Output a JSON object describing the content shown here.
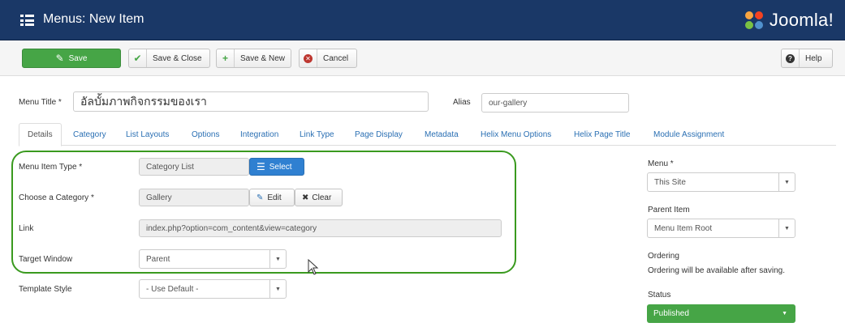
{
  "header": {
    "title": "Menus: New Item",
    "logo_text": "Joomla!",
    "colors": {
      "bar": "#1a3867"
    }
  },
  "toolbar": {
    "save_label": "Save",
    "save_close_label": "Save & Close",
    "save_new_label": "Save & New",
    "cancel_label": "Cancel",
    "help_label": "Help"
  },
  "form": {
    "menu_title_label": "Menu Title *",
    "menu_title_value": "อัลบั้มภาพกิจกรรมของเรา",
    "alias_label": "Alias",
    "alias_value": "our-gallery"
  },
  "tabs": [
    {
      "label": "Details"
    },
    {
      "label": "Category"
    },
    {
      "label": "List Layouts"
    },
    {
      "label": "Options"
    },
    {
      "label": "Integration"
    },
    {
      "label": "Link Type"
    },
    {
      "label": "Page Display"
    },
    {
      "label": "Metadata"
    },
    {
      "label": "Helix Menu Options"
    },
    {
      "label": "Helix Page Title"
    },
    {
      "label": "Module Assignment"
    }
  ],
  "details": {
    "menu_item_type_label": "Menu Item Type *",
    "menu_item_type_value": "Category List",
    "select_label": "Select",
    "category_label": "Choose a Category *",
    "category_value": "Gallery",
    "edit_label": "Edit",
    "clear_label": "Clear",
    "link_label": "Link",
    "link_value": "index.php?option=com_content&view=category",
    "target_label": "Target Window",
    "target_value": "Parent",
    "template_label": "Template Style",
    "template_value": "- Use Default -"
  },
  "sidebar": {
    "menu_label": "Menu *",
    "menu_value": "This Site",
    "parent_label": "Parent Item",
    "parent_value": "Menu Item Root",
    "ordering_label": "Ordering",
    "ordering_note": "Ordering will be available after saving.",
    "status_label": "Status",
    "status_value": "Published",
    "status_color": "#46a546"
  }
}
